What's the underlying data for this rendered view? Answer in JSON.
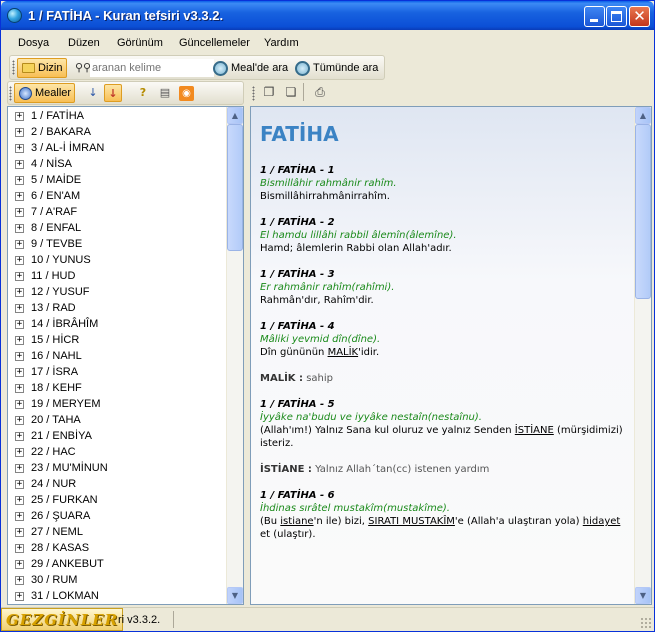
{
  "window": {
    "title": "1 / FATİHA - Kuran tefsiri v3.3.2."
  },
  "menu": [
    "Dosya",
    "Düzen",
    "Görünüm",
    "Güncellemeler",
    "Yardım"
  ],
  "search_toolbar": {
    "dizin_label": "Dizin",
    "search_placeholder": "aranan kelime",
    "search_in_meal_label": "Meal'de ara",
    "search_all_label": "Tümünde ara"
  },
  "left_toolbar": {
    "mealler_label": "Mealler",
    "icons": [
      "sort-asc-icon",
      "sort-desc-icon",
      "help-icon",
      "notes-icon",
      "rss-icon"
    ]
  },
  "right_toolbar": {
    "icons": [
      "copy-icon",
      "paste-icon",
      "print-icon"
    ]
  },
  "suras": [
    "1 / FATİHA",
    "2 / BAKARA",
    "3 / AL-İ İMRAN",
    "4 / NİSA",
    "5 / MAİDE",
    "6 / EN'AM",
    "7 / A'RAF",
    "8 / ENFAL",
    "9 / TEVBE",
    "10 / YUNUS",
    "11 / HUD",
    "12 / YUSUF",
    "13 / RAD",
    "14 / İBRÂHÎM",
    "15 / HİCR",
    "16 / NAHL",
    "17 / İSRA",
    "18 / KEHF",
    "19 / MERYEM",
    "20 / TAHA",
    "21 / ENBİYA",
    "22 / HAC",
    "23 / MU'MİNUN",
    "24 / NUR",
    "25 / FURKAN",
    "26 / ŞUARA",
    "27 / NEML",
    "28 / KASAS",
    "29 / ANKEBUT",
    "30 / RUM",
    "31 / LOKMAN"
  ],
  "content": {
    "sura_title": "FATİHA",
    "v1": {
      "head": "1 / FATİHA - 1",
      "arabic": "Bismillâhir rahmânir rahîm.",
      "meal": "Bismillâhirrahmânirrahîm."
    },
    "v2": {
      "head": "1 / FATİHA - 2",
      "arabic": "El hamdu lillâhi rabbil âlemîn(âlemîne).",
      "meal": "Hamd; âlemlerin Rabbi olan Allah'adır."
    },
    "v3": {
      "head": "1 / FATİHA - 3",
      "arabic": "Er rahmânir rahîm(rahîmi).",
      "meal": "Rahmân'dır, Rahîm'dir."
    },
    "v4": {
      "head": "1 / FATİHA - 4",
      "arabic": "Mâliki yevmid dîn(dîne).",
      "meal_pre": "Dîn gününün ",
      "meal_link": "MALİK",
      "meal_post": "'idir."
    },
    "note1": {
      "term": "MALİK :",
      "text": " sahip"
    },
    "v5": {
      "head": "1 / FATİHA - 5",
      "arabic": "İyyâke na'budu ve iyyâke nestaîn(nestaînu).",
      "meal_pre": "(Allah'ım!) Yalnız Sana kul oluruz ve yalnız Senden ",
      "meal_link": "İSTİANE",
      "meal_post": " (mürşidimizi) isteriz."
    },
    "note2": {
      "term": "İSTİANE :",
      "text": " Yalnız Allah´tan(cc) istenen yardım"
    },
    "v6": {
      "head": "1 / FATİHA - 6",
      "arabic": "İhdinas sırâtel mustakîm(mustakîme).",
      "meal_a": "(Bu ",
      "meal_link1": "istiane",
      "meal_b": "'n ile) bizi, ",
      "meal_link2": "SIRATI MUSTAKÎM",
      "meal_c": "'e (Allah'a ulaştıran yola) ",
      "meal_link3": "hidayet",
      "meal_d": " et (ulaştır)."
    }
  },
  "statusbar": {
    "text": "ri v3.3.2.",
    "watermark": "GEZGİNLER"
  }
}
